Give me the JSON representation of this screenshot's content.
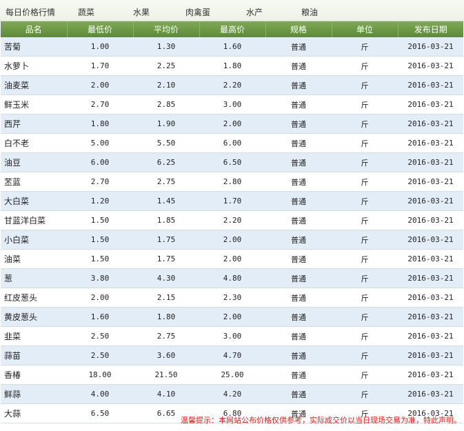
{
  "tabs": {
    "title": "每日价格行情",
    "items": [
      "蔬菜",
      "水果",
      "肉禽蛋",
      "水产",
      "粮油"
    ]
  },
  "table": {
    "headers": [
      "品名",
      "最低价",
      "平均价",
      "最高价",
      "规格",
      "单位",
      "发布日期"
    ],
    "rows": [
      [
        "苦菊",
        "1.00",
        "1.30",
        "1.60",
        "普通",
        "斤",
        "2016-03-21"
      ],
      [
        "水萝卜",
        "1.70",
        "2.25",
        "1.80",
        "普通",
        "斤",
        "2016-03-21"
      ],
      [
        "油麦菜",
        "2.00",
        "2.10",
        "2.20",
        "普通",
        "斤",
        "2016-03-21"
      ],
      [
        "鲜玉米",
        "2.70",
        "2.85",
        "3.00",
        "普通",
        "斤",
        "2016-03-21"
      ],
      [
        "西芹",
        "1.80",
        "1.90",
        "2.00",
        "普通",
        "斤",
        "2016-03-21"
      ],
      [
        "白不老",
        "5.00",
        "5.50",
        "6.00",
        "普通",
        "斤",
        "2016-03-21"
      ],
      [
        "油豆",
        "6.00",
        "6.25",
        "6.50",
        "普通",
        "斤",
        "2016-03-21"
      ],
      [
        "苤蓝",
        "2.70",
        "2.75",
        "2.80",
        "普通",
        "斤",
        "2016-03-21"
      ],
      [
        "大白菜",
        "1.20",
        "1.45",
        "1.70",
        "普通",
        "斤",
        "2016-03-21"
      ],
      [
        "甘蓝洋白菜",
        "1.50",
        "1.85",
        "2.20",
        "普通",
        "斤",
        "2016-03-21"
      ],
      [
        "小白菜",
        "1.50",
        "1.75",
        "2.00",
        "普通",
        "斤",
        "2016-03-21"
      ],
      [
        "油菜",
        "1.50",
        "1.75",
        "2.00",
        "普通",
        "斤",
        "2016-03-21"
      ],
      [
        "葱",
        "3.80",
        "4.30",
        "4.80",
        "普通",
        "斤",
        "2016-03-21"
      ],
      [
        "红皮葱头",
        "2.00",
        "2.15",
        "2.30",
        "普通",
        "斤",
        "2016-03-21"
      ],
      [
        "黄皮葱头",
        "1.60",
        "1.80",
        "2.00",
        "普通",
        "斤",
        "2016-03-21"
      ],
      [
        "韭菜",
        "2.50",
        "2.75",
        "3.00",
        "普通",
        "斤",
        "2016-03-21"
      ],
      [
        "蒜苗",
        "2.50",
        "3.60",
        "4.70",
        "普通",
        "斤",
        "2016-03-21"
      ],
      [
        "香椿",
        "18.00",
        "21.50",
        "25.00",
        "普通",
        "斤",
        "2016-03-21"
      ],
      [
        "鲜蒜",
        "4.00",
        "4.10",
        "4.20",
        "普通",
        "斤",
        "2016-03-21"
      ],
      [
        "大蒜",
        "6.50",
        "6.65",
        "6.80",
        "普通",
        "斤",
        "2016-03-21"
      ]
    ]
  },
  "notice": "温馨提示：本网站公布价格仅供参考，实际成交价以当日现场交易为准，特此声明。",
  "colors": {
    "header_green": "#6a9642",
    "row_alt": "#e3edf7",
    "notice_red": "#e0201b"
  }
}
